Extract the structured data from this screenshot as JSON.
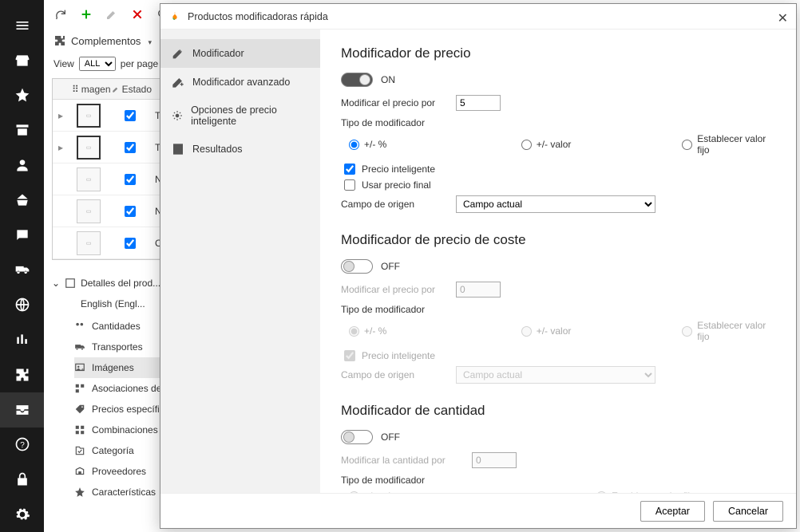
{
  "toolbar": {},
  "complementos_label": "Complementos",
  "view": {
    "label": "View",
    "value": "ALL",
    "per_page": "per page"
  },
  "grid": {
    "col_img": "magen",
    "col_estado": "Estado",
    "rows": [
      {
        "text": "T... P..."
      },
      {
        "text": "T... p..."
      },
      {
        "text": "N..."
      },
      {
        "text": "N..."
      },
      {
        "text": "C..."
      }
    ]
  },
  "details": {
    "title": "Detalles del prod...",
    "lang": "English (Engl...",
    "items": [
      "Cantidades",
      "Transportes",
      "Imágenes",
      "Asociaciones de t...",
      "Precios específico...",
      "Combinaciones",
      "Categoría",
      "Proveedores",
      "Características"
    ]
  },
  "modal": {
    "title": "Productos modificadoras rápida",
    "nav": [
      "Modificador",
      "Modificador avanzado",
      "Opciones de precio inteligente",
      "Resultados"
    ],
    "price": {
      "heading": "Modificador de precio",
      "toggle": "ON",
      "modify_label": "Modificar el precio por",
      "modify_value": "5",
      "type_label": "Tipo de modificador",
      "radios": [
        "+/- %",
        "+/- valor",
        "Establecer valor fijo"
      ],
      "smart_price": "Precio inteligente",
      "use_final": "Usar precio final",
      "source_label": "Campo de origen",
      "source_value": "Campo actual"
    },
    "cost": {
      "heading": "Modificador de precio de coste",
      "toggle": "OFF",
      "modify_label": "Modificar el precio por",
      "modify_value": "0",
      "type_label": "Tipo de modificador",
      "radios": [
        "+/- %",
        "+/- valor",
        "Establecer valor fijo"
      ],
      "smart_price": "Precio inteligente",
      "source_label": "Campo de origen",
      "source_value": "Campo actual"
    },
    "qty": {
      "heading": "Modificador de cantidad",
      "toggle": "OFF",
      "modify_label": "Modificar la cantidad por",
      "modify_value": "0",
      "type_label": "Tipo de modificador",
      "radios": [
        "+/- valor",
        "Establecer valor fijo"
      ]
    },
    "accept": "Aceptar",
    "cancel": "Cancelar"
  }
}
